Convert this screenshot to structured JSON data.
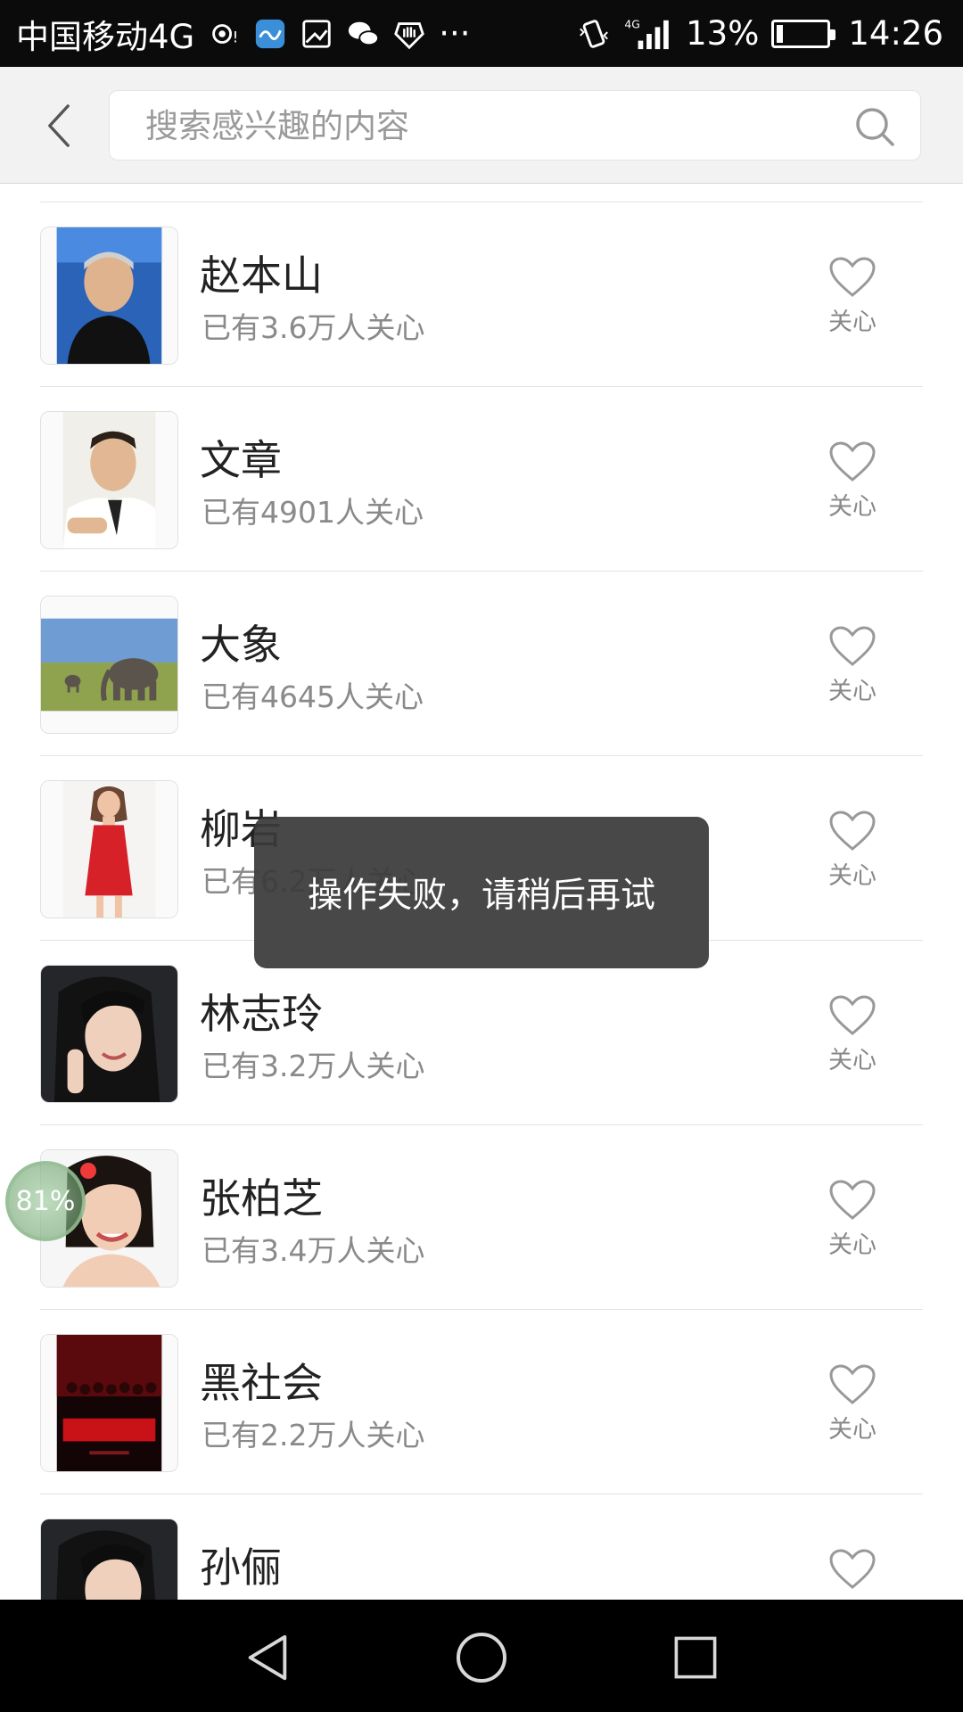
{
  "status_bar": {
    "carrier": "中国移动4G",
    "network": "4G",
    "battery_text": "13%",
    "battery_level": 0.13,
    "time": "14:26",
    "more": "···"
  },
  "search": {
    "placeholder": "搜索感兴趣的内容",
    "value": ""
  },
  "items": [
    {
      "name": "赵本山",
      "count": "已有3.6万人关心",
      "follow_label": "关心",
      "image": "portrait-man"
    },
    {
      "name": "文章",
      "count": "已有4901人关心",
      "follow_label": "关心",
      "image": "portrait-man-white-shirt"
    },
    {
      "name": "大象",
      "count": "已有4645人关心",
      "follow_label": "关心",
      "image": "elephant-landscape"
    },
    {
      "name": "柳岩",
      "count": "已有6.2万人关心",
      "follow_label": "关心",
      "image": "woman-red-dress"
    },
    {
      "name": "林志玲",
      "count": "已有3.2万人关心",
      "follow_label": "关心",
      "image": "portrait-woman"
    },
    {
      "name": "张柏芝",
      "count": "已有3.4万人关心",
      "follow_label": "关心",
      "image": "portrait-woman-smiling"
    },
    {
      "name": "黑社会",
      "count": "已有2.2万人关心",
      "follow_label": "关心",
      "image": "movie-poster"
    },
    {
      "name": "孙俪",
      "count": "",
      "follow_label": "",
      "image": "portrait-woman"
    }
  ],
  "toast": {
    "message": "操作失败，请稍后再试"
  },
  "floating_badge": {
    "text": "81%"
  },
  "colors": {
    "header_bg": "#f2f2f2",
    "toast_bg": "#3a3a3a",
    "secondary_text": "#8a8a8a"
  }
}
